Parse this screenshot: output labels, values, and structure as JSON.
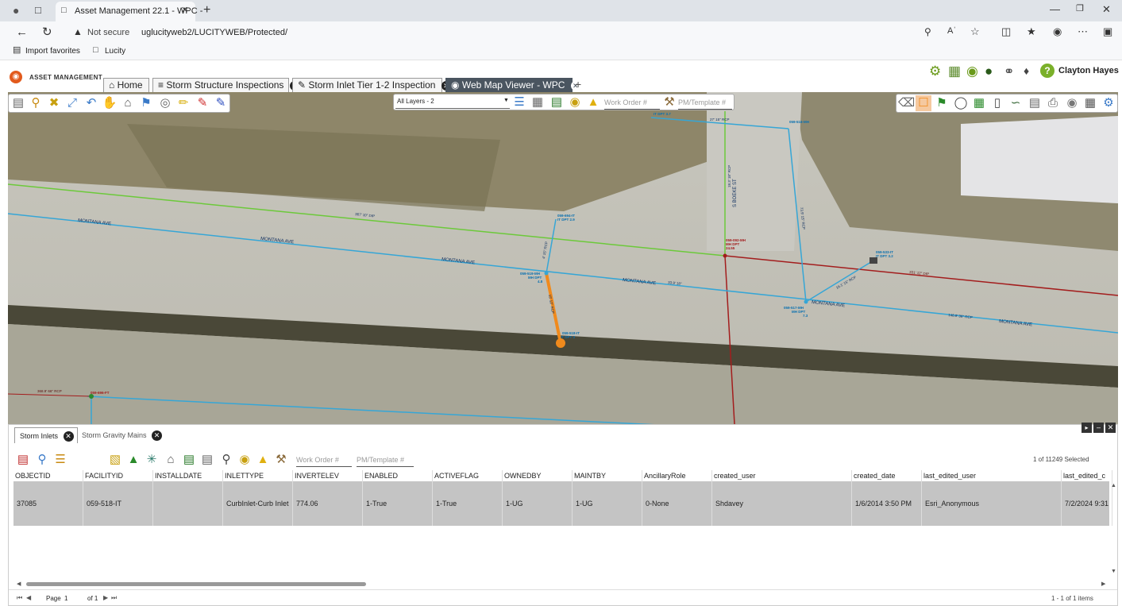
{
  "browser": {
    "tab_title": "Asset Management 22.1 - WPC - ",
    "security_label": "Not secure",
    "url": "uglucityweb2/LUCITYWEB/Protected/",
    "favorites": [
      "Import favorites",
      "Lucity"
    ]
  },
  "app": {
    "logo_text": "ASSET MANAGEMENT",
    "user_name": "Clayton Hayes",
    "tabs": [
      {
        "label": "Home",
        "icon": "home-icon"
      },
      {
        "label": "Storm Structure Inspections",
        "icon": "list-icon"
      },
      {
        "label": "Storm Inlet Tier 1-2 Inspection",
        "icon": "pencil-icon"
      },
      {
        "label": "Web Map Viewer - WPC",
        "icon": "globe-icon",
        "active": true
      }
    ]
  },
  "map": {
    "layer_select": "All Layers - 2",
    "work_order_placeholder": "Work Order #",
    "pm_template_placeholder": "PM/Template #",
    "labels": {
      "montana_1": "MONTANA AVE",
      "montana_2": "MONTANA AVE",
      "montana_3": "MONTANA AVE",
      "montana_4": "MONTANA AVE",
      "montana_5": "MONTANA AVE",
      "montana_6": "MONTANA AVE",
      "boeke": "S BOEKE ST",
      "pipe_green": "367' 10\" DIP",
      "pipe_red": "331' 12\" DIP",
      "pipe_blue_east": "146.9' 36\" RCP",
      "pipe_blue_mid": "33.9' 18\"",
      "pipe_orange": "15' 12\" RCP",
      "pipe_vert_n": "18.3' 18\" RCP",
      "pipe_vert_e": "73.9' 15\" RCP",
      "pipe_diag": "16.1' 15\" RCP",
      "pipe_short": "4' 15\" RCP",
      "pipe_top": "27' 15\" RCP",
      "pipe_sw": "368.9' 66\" RCP",
      "node_mh_west": "059-519-MH\nMH DPT\n4.8",
      "node_mh_center": "059-092-MH\nMH DPT\n24.55",
      "node_mh_east": "059-517-MH\nMH DPT\n7.3",
      "node_it_north": "059-694-IT\nIT DPT 2.9",
      "node_it_sel": "059-518-IT\nIT DPT 3",
      "node_it_east": "059-533-IT\nIT DPT 3.2",
      "node_it_top": "IT DPT 3.7",
      "node_ne": "059-516-MH",
      "node_ft": "059-696-FT"
    }
  },
  "grid": {
    "tabs": [
      {
        "label": "Storm Inlets",
        "active": true
      },
      {
        "label": "Storm Gravity Mains"
      }
    ],
    "work_order_placeholder": "Work Order #",
    "pm_template_placeholder": "PM/Template #",
    "selection_count": "1 of 11249 Selected",
    "columns": [
      "OBJECTID",
      "FACILITYID",
      "INSTALLDATE",
      "INLETTYPE",
      "INVERTELEV",
      "ENABLED",
      "ACTIVEFLAG",
      "OWNEDBY",
      "MAINTBY",
      "AncillaryRole",
      "created_user",
      "created_date",
      "last_edited_user",
      "last_edited_c"
    ],
    "rows": [
      [
        "37085",
        "059-518-IT",
        "",
        "CurbInlet-Curb Inlet",
        "774.06",
        "1-True",
        "1-True",
        "1-UG",
        "1-UG",
        "0-None",
        "Shdavey",
        "1/6/2014 3:50 PM",
        "Esri_Anonymous",
        "7/2/2024 9:31"
      ]
    ],
    "pager": {
      "page_label": "Page",
      "page": "1",
      "of_label": "of 1",
      "items": "1 - 1 of 1 items"
    }
  },
  "colors": {
    "active_tab": "#4a5560",
    "pipe_blue": "#36a6d6",
    "pipe_green": "#6cc93a",
    "pipe_red": "#a31d1d",
    "selected": "#f08a1c",
    "row_selected": "#c4c4c4"
  }
}
